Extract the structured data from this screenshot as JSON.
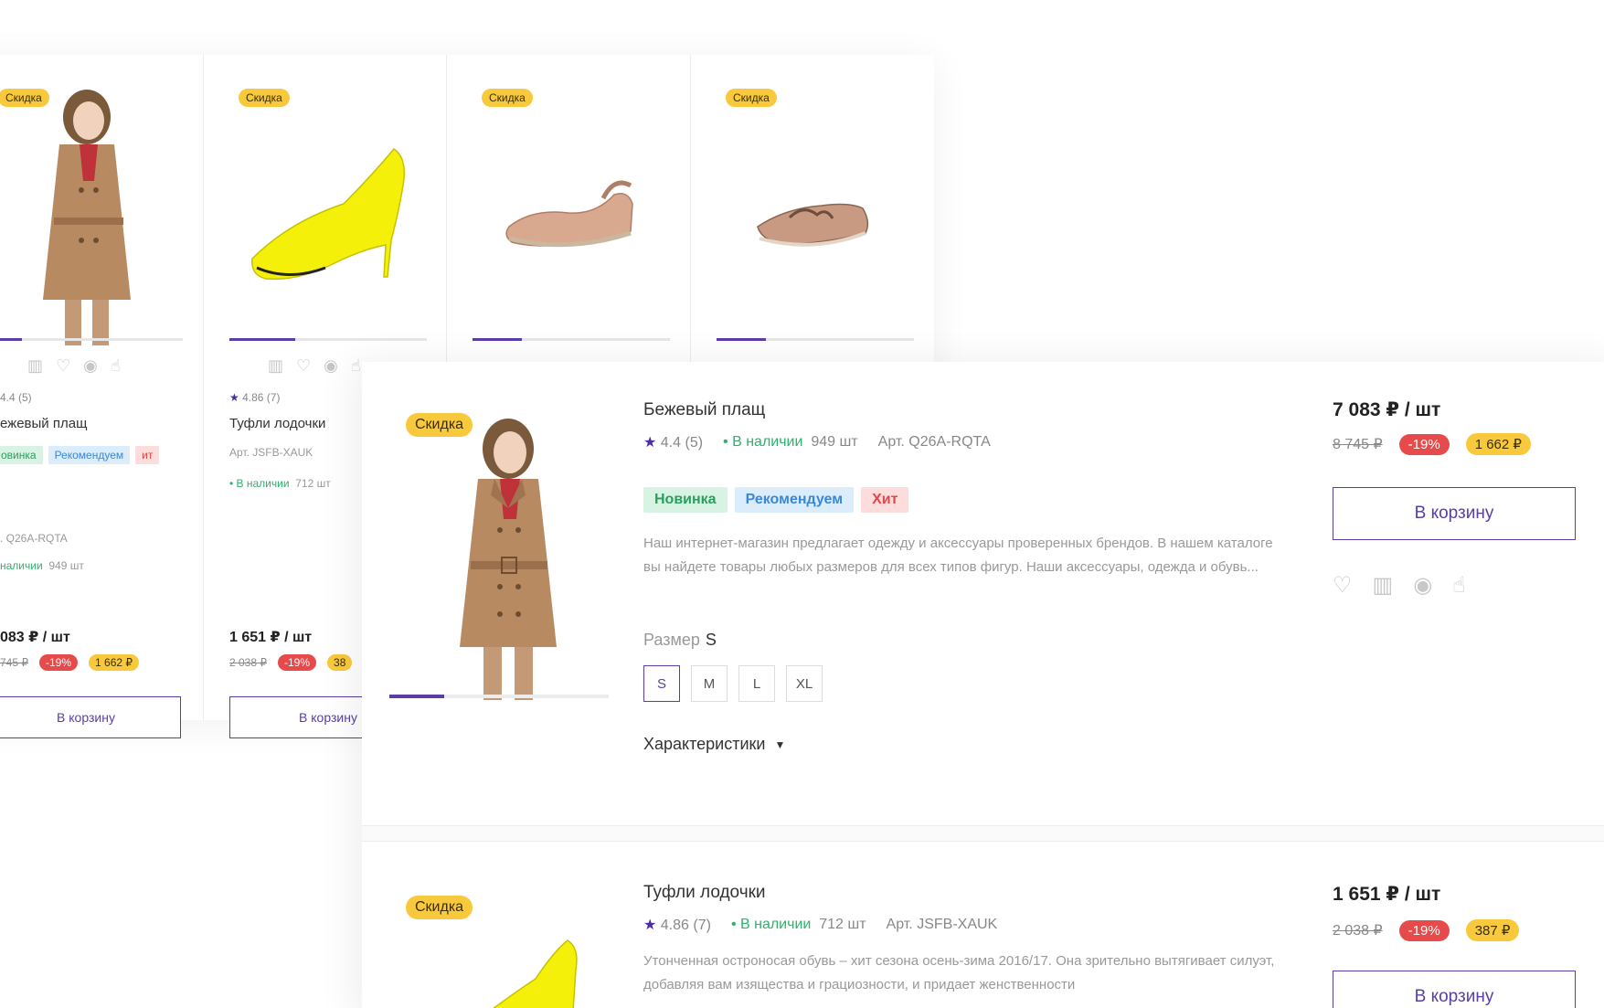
{
  "colors": {
    "accent": "#5b3da6",
    "badge": "#f8c93d",
    "discount": "#e74a4a",
    "in_stock": "#2fb16b"
  },
  "grid_cards": [
    {
      "badge": "Скидка",
      "rating": "4.4 (5)",
      "name": "ежевый плащ",
      "tags": [
        "овинка",
        "Рекомендуем",
        "ит"
      ],
      "article": ". Q26A-RQTA",
      "stock_label": "наличии",
      "stock_count": "949 шт",
      "price": "083 ₽ / шт",
      "old_price": "745 ₽",
      "discount": "-19%",
      "savings": "1 662 ₽",
      "button": "В корзину",
      "slider_fill": 0.16
    },
    {
      "badge": "Скидка",
      "rating": "4.86 (7)",
      "name": "Туфли лодочки",
      "article": "Арт. JSFB-XAUK",
      "stock_label": "• В наличии",
      "stock_count": "712 шт",
      "price": "1 651 ₽ / шт",
      "old_price": "2 038 ₽",
      "discount": "-19%",
      "savings": "38",
      "button": "В корзину",
      "slider_fill": 0.33
    },
    {
      "badge": "Скидка",
      "slider_fill": 0.25
    },
    {
      "badge": "Скидка",
      "slider_fill": 0.25
    }
  ],
  "list_items": [
    {
      "badge": "Скидка",
      "title": "Бежевый плащ",
      "rating": "4.4 (5)",
      "stock_label": "• В наличии",
      "stock_count": "949 шт",
      "article": "Арт. Q26A-RQTA",
      "tags": [
        "Новинка",
        "Рекомендуем",
        "Хит"
      ],
      "description": "Наш интернет-магазин предлагает одежду и аксессуары проверенных брендов. В нашем каталоге вы найдете товары любых размеров для всех типов фигур. Наши аксессуары, одежда и обувь...",
      "size_label": "Размер",
      "size_value": "S",
      "sizes": [
        "S",
        "M",
        "L",
        "XL"
      ],
      "characteristics": "Характеристики",
      "price": "7 083 ₽ / шт",
      "old_price": "8 745 ₽",
      "discount": "-19%",
      "savings": "1 662 ₽",
      "button": "В корзину"
    },
    {
      "badge": "Скидка",
      "title": "Туфли лодочки",
      "rating": "4.86 (7)",
      "stock_label": "• В наличии",
      "stock_count": "712 шт",
      "article": "Арт. JSFB-XAUK",
      "description": "Утонченная остроносая обувь – хит сезона осень-зима 2016/17. Она зрительно вытягивает силуэт, добавляя вам изящества и грациозности, и придает женственности",
      "price": "1 651 ₽ / шт",
      "old_price": "2 038 ₽",
      "discount": "-19%",
      "savings": "387 ₽",
      "button": "В корзину"
    }
  ],
  "icons": [
    "compare-icon",
    "heart-icon",
    "eye-icon",
    "quick-click-icon",
    "star-icon",
    "chevron-down-icon"
  ]
}
